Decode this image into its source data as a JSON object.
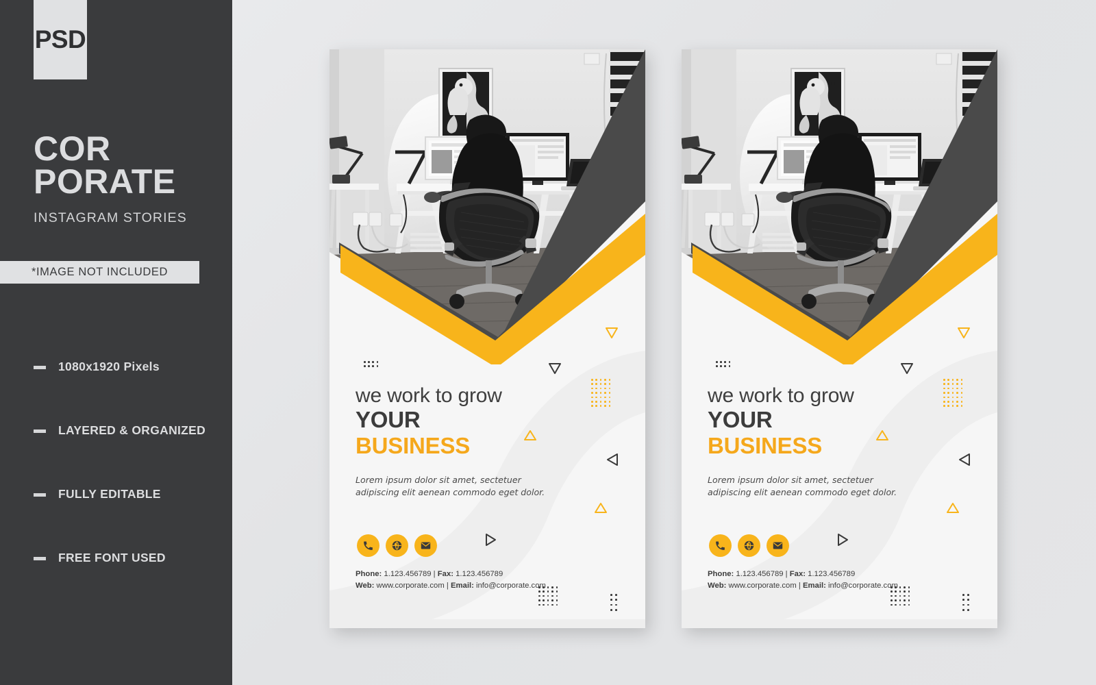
{
  "sidebar": {
    "badge": "PSD",
    "brand_line1": "COR",
    "brand_line2": "PORATE",
    "subtitle": "INSTAGRAM STORIES",
    "notice": "*IMAGE NOT INCLUDED",
    "features": [
      "1080x1920\nPixels",
      "LAYERED &\nORGANIZED",
      "FULLY\nEDITABLE",
      "FREE FONT\nUSED"
    ]
  },
  "poster": {
    "headline_line1": "we work to grow",
    "headline_line2": "YOUR",
    "headline_line3": "BUSINESS",
    "lede": "Lorem ipsum dolor sit amet, sectetuer adipiscing elit aenean commodo  eget dolor.",
    "contact_line1_label_phone": "Phone:",
    "contact_line1_phone": " 1.123.456789 | ",
    "contact_line1_label_fax": "Fax:",
    "contact_line1_fax": " 1.123.456789",
    "contact_line2_label_web": "Web:",
    "contact_line2_web": " www.corporate.com | ",
    "contact_line2_label_email": "Email:",
    "contact_line2_email": " info@corporate.com",
    "icons": [
      "phone-icon",
      "globe-icon",
      "email-icon"
    ]
  },
  "colors": {
    "sidebar_bg": "#3a3b3d",
    "sidebar_text": "#dcdddf",
    "badge_bg": "#e0e1e3",
    "canvas_bg": "#e2e3e5",
    "card_bg": "#f6f6f6",
    "accent_yellow": "#f8b41b",
    "headline_yellow": "#f5a81c",
    "dark_gray": "#4a4a4a",
    "text_dark": "#3c3c3c"
  }
}
